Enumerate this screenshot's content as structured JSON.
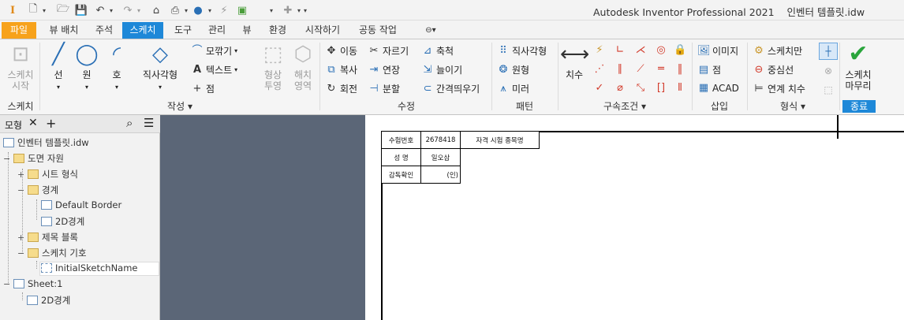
{
  "app": {
    "title": "Autodesk Inventor Professional 2021",
    "document": "인벤터 템플릿.idw"
  },
  "quick_access": {
    "logo": "I",
    "icons": [
      "new-document-icon",
      "open-folder-icon",
      "save-icon",
      "undo-icon",
      "redo-icon",
      "home-icon",
      "print-icon",
      "measure-icon",
      "update-icon",
      "color-swatch-icon",
      "add-icon"
    ]
  },
  "tabs": [
    "파일",
    "뷰 배치",
    "주석",
    "스케치",
    "도구",
    "관리",
    "뷰",
    "환경",
    "시작하기",
    "공동 작업"
  ],
  "ribbon": {
    "sketch_start": {
      "label1": "스케치",
      "label2": "시작"
    },
    "panel_sketch": "스케치",
    "create": {
      "line": "선",
      "circle": "원",
      "arc": "호",
      "rectangle": "직사각형",
      "fillet": "모깎기",
      "text": "텍스트",
      "point": "점",
      "shape1": "형상",
      "shape2": "투영",
      "hatch1": "해치",
      "hatch2": "영역"
    },
    "panel_create": "작성",
    "modify": {
      "move": "이동",
      "copy": "복사",
      "rotate": "회전",
      "trim": "자르기",
      "extend": "연장",
      "split": "분할",
      "scale": "축척",
      "stretch": "늘이기",
      "offset": "간격띄우기"
    },
    "panel_modify": "수정",
    "pattern": {
      "rect": "직사각형",
      "circular": "원형",
      "mirror": "미러"
    },
    "panel_pattern": "패턴",
    "dimension": "치수",
    "panel_constrain": "구속조건",
    "insert": {
      "image": "이미지",
      "point": "점",
      "acad": "ACAD"
    },
    "panel_insert": "삽입",
    "format": {
      "sketch_only": "스케치만",
      "centerline": "중심선",
      "driven": "연계 치수"
    },
    "panel_format": "형식",
    "finish1": "스케치",
    "finish2": "마무리",
    "panel_exit": "종료"
  },
  "browser": {
    "tab": "모형",
    "items": [
      "인벤터 템플릿.idw",
      "도면 자원",
      "시트 형식",
      "경계",
      "Default Border",
      "2D경계",
      "제목 블록",
      "스케치 기호",
      "InitialSketchName",
      "Sheet:1",
      "2D경계"
    ]
  },
  "title_block": {
    "r1c1": "수험번호",
    "r1c2": "2678418",
    "r1c3": "자격 시험 종목명",
    "r2c1": "성     명",
    "r2c2": "일오삼",
    "r3c1": "감독확인",
    "r3c2": "(인)"
  },
  "colors": {
    "file_tab": "#f7a21b",
    "active_tab": "#1e88d8",
    "canvas": "#5b6677",
    "finish_check": "#2aa53c"
  }
}
